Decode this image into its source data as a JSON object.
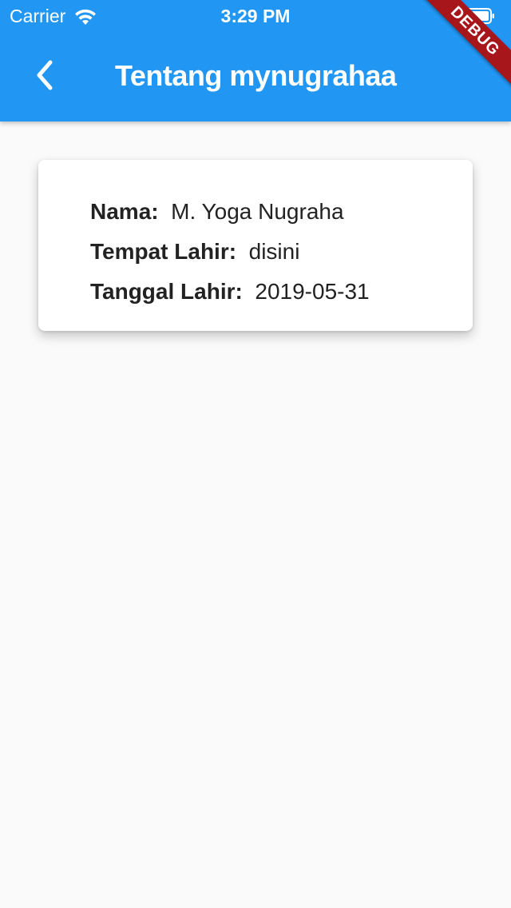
{
  "status_bar": {
    "carrier": "Carrier",
    "time": "3:29 PM",
    "icons": [
      "wifi-icon",
      "battery-icon"
    ]
  },
  "app_bar": {
    "title": "Tentang mynugrahaa",
    "back_icon": "chevron-left-icon",
    "background_color": "#2196f3"
  },
  "debug_banner": {
    "label": "DEBUG",
    "color": "#a6161b"
  },
  "profile": {
    "rows": [
      {
        "label": "Nama:",
        "value": "M. Yoga Nugraha"
      },
      {
        "label": "Tempat Lahir:",
        "value": "disini"
      },
      {
        "label": "Tanggal Lahir:",
        "value": "2019-05-31"
      }
    ]
  },
  "page": {
    "background_color": "#fafafa"
  }
}
